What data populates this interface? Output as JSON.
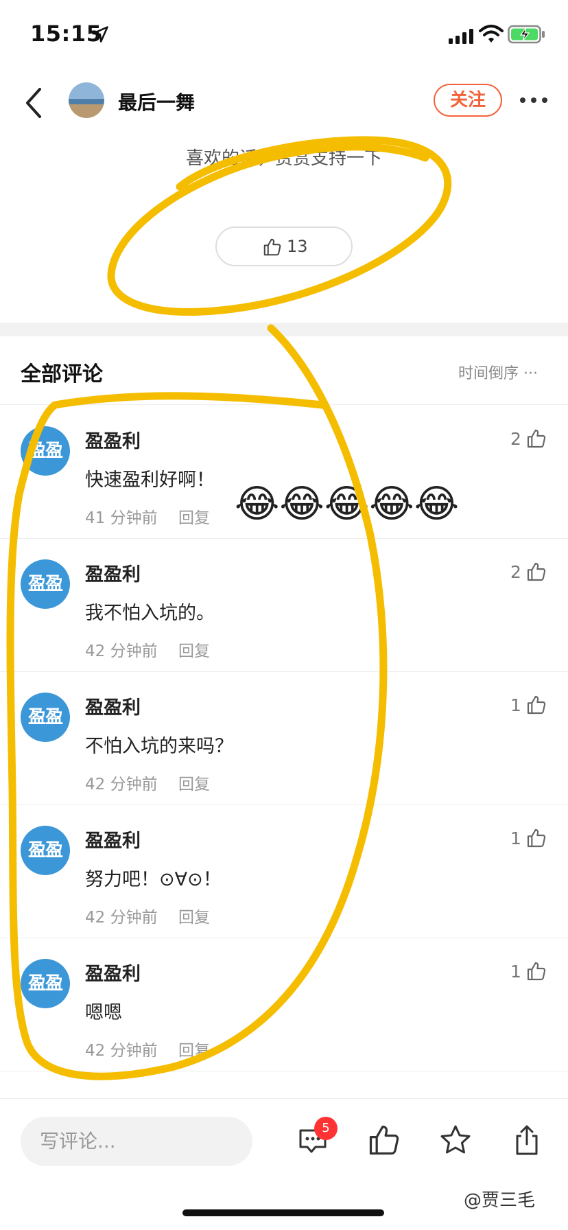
{
  "status_bar": {
    "time": "15:15"
  },
  "nav": {
    "author_name": "最后一舞",
    "follow_label": "关注"
  },
  "reward": {
    "text": "喜欢的话，赏赏支持一下",
    "like_count": "13"
  },
  "comments_section": {
    "title": "全部评论",
    "sort_label": "时间倒序 ···"
  },
  "comments": [
    {
      "avatar_text": "盈盈",
      "name": "盈盈利",
      "text": "快速盈利好啊！",
      "time": "41 分钟前",
      "reply": "回复",
      "likes": "2"
    },
    {
      "avatar_text": "盈盈",
      "name": "盈盈利",
      "text": "我不怕入坑的。",
      "time": "42 分钟前",
      "reply": "回复",
      "likes": "2"
    },
    {
      "avatar_text": "盈盈",
      "name": "盈盈利",
      "text": "不怕入坑的来吗？",
      "time": "42 分钟前",
      "reply": "回复",
      "likes": "1"
    },
    {
      "avatar_text": "盈盈",
      "name": "盈盈利",
      "text": "努力吧！⊙∀⊙！",
      "time": "42 分钟前",
      "reply": "回复",
      "likes": "1"
    },
    {
      "avatar_text": "盈盈",
      "name": "盈盈利",
      "text": "嗯嗯",
      "time": "42 分钟前",
      "reply": "回复",
      "likes": "1"
    }
  ],
  "emoji_overlay": "😂😂😂😂😂",
  "bottom_bar": {
    "input_placeholder": "写评论...",
    "comment_badge": "5"
  },
  "watermark": "@贾三毛",
  "colors": {
    "accent": "#f2623a",
    "avatar_blue": "#3b97d7",
    "annotation_yellow": "#f5bd00",
    "badge_red": "#ff3333"
  },
  "icons": {
    "status": [
      "location-arrow-icon",
      "signal-icon",
      "wifi-icon",
      "battery-charging-icon"
    ],
    "nav": [
      "back-chevron-icon",
      "more-dots-icon"
    ],
    "bottom": [
      "comment-icon",
      "thumbs-up-icon",
      "star-icon",
      "share-icon"
    ]
  }
}
